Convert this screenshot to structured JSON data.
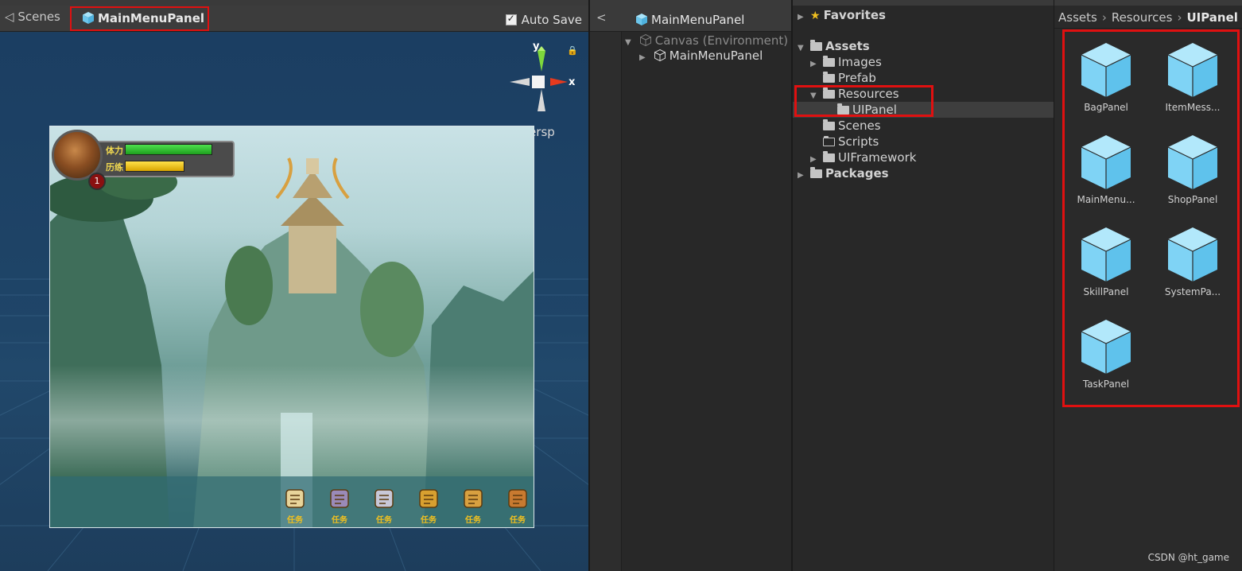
{
  "scene": {
    "breadcrumb_root": "Scenes",
    "breadcrumb_current": "MainMenuPanel",
    "auto_save_label": "Auto Save",
    "auto_save_checked": true,
    "gizmo_y": "y",
    "gizmo_x": "x",
    "projection": "<Persp",
    "hud": {
      "stamina_label": "体力",
      "experience_label": "历练",
      "level": "1",
      "stamina_fraction": 0.95,
      "experience_fraction": 0.65
    },
    "menu_buttons": [
      {
        "label": "任务",
        "icon": "scroll-icon"
      },
      {
        "label": "任务",
        "icon": "gear-gem-icon"
      },
      {
        "label": "任务",
        "icon": "crossed-swords-icon"
      },
      {
        "label": "任务",
        "icon": "book-icon"
      },
      {
        "label": "任务",
        "icon": "treasure-chest-icon"
      },
      {
        "label": "任务",
        "icon": "backpack-icon"
      }
    ]
  },
  "hierarchy": {
    "title": "MainMenuPanel",
    "rows": [
      {
        "label": "Canvas (Environment)"
      },
      {
        "label": "MainMenuPanel"
      }
    ]
  },
  "project": {
    "favorites": "Favorites",
    "assets": "Assets",
    "images": "Images",
    "prefab": "Prefab",
    "resources": "Resources",
    "uipanel": "UIPanel",
    "scenes": "Scenes",
    "scripts": "Scripts",
    "uiframework": "UIFramework",
    "packages": "Packages"
  },
  "asset_view": {
    "breadcrumb": [
      "Assets",
      "Resources",
      "UIPanel"
    ],
    "items": [
      {
        "label": "BagPanel"
      },
      {
        "label": "ItemMess..."
      },
      {
        "label": "MainMenu..."
      },
      {
        "label": "ShopPanel"
      },
      {
        "label": "SkillPanel"
      },
      {
        "label": "SystemPa..."
      },
      {
        "label": "TaskPanel"
      }
    ]
  },
  "watermark": "CSDN @ht_game",
  "colors": {
    "highlight": "#e01010",
    "prefab_cube": "#7fd3f5",
    "scene_bg": "#1f3e5c"
  }
}
